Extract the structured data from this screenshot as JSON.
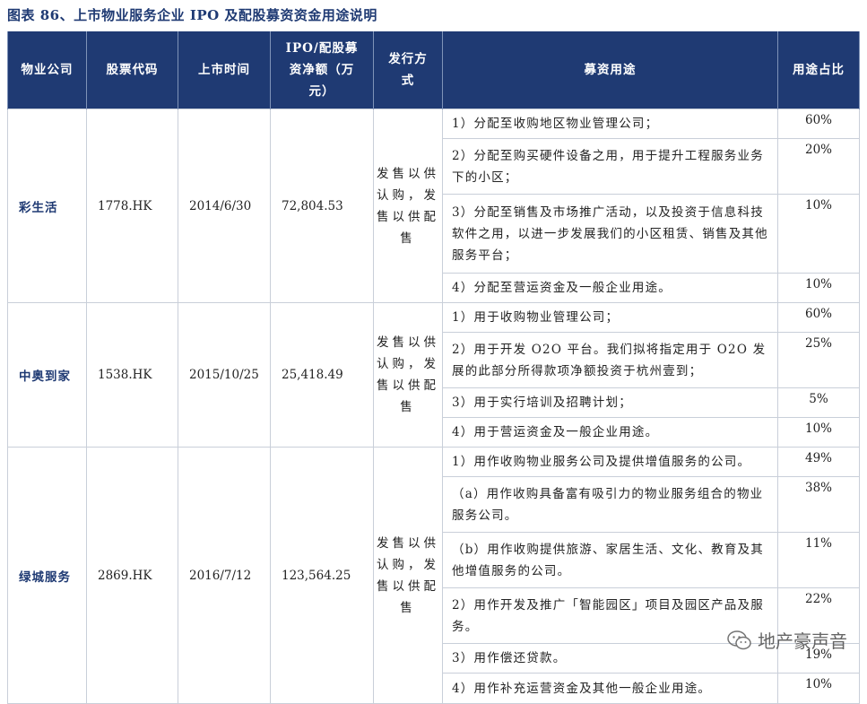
{
  "caption": "图表 86、上市物业服务企业 IPO 及配股募资资金用途说明",
  "headers": {
    "company": "物业公司",
    "code": "股票代码",
    "date": "上市时间",
    "amount": "IPO/配股募资净额（万元）",
    "method": "发行方式",
    "use": "募资用途",
    "pct": "用途占比"
  },
  "rows": [
    {
      "company": "彩生活",
      "code": "1778.HK",
      "date": "2014/6/30",
      "amount": "72,804.53",
      "method": "发售以供认购，发售以供配售",
      "uses": [
        {
          "text": "1）分配至收购地区物业管理公司；",
          "pct": "60%"
        },
        {
          "text": "2）分配至购买硬件设备之用，用于提升工程服务业务下的小区；",
          "pct": "20%"
        },
        {
          "text": "3）分配至销售及市场推广活动，以及投资于信息科技软件之用，以进一步发展我们的小区租赁、销售及其他服务平台；",
          "pct": "10%"
        },
        {
          "text": "4）分配至营运资金及一般企业用途。",
          "pct": "10%"
        }
      ]
    },
    {
      "company": "中奥到家",
      "code": "1538.HK",
      "date": "2015/10/25",
      "amount": "25,418.49",
      "method": "发售以供认购，发售以供配售",
      "uses": [
        {
          "text": "1）用于收购物业管理公司；",
          "pct": "60%"
        },
        {
          "text": "2）用于开发 O2O 平台。我们拟将指定用于 O2O 发展的此部分所得款项净额投资于杭州壹到；",
          "pct": "25%"
        },
        {
          "text": "3）用于实行培训及招聘计划；",
          "pct": "5%"
        },
        {
          "text": "4）用于营运资金及一般企业用途。",
          "pct": "10%"
        }
      ]
    },
    {
      "company": "绿城服务",
      "code": "2869.HK",
      "date": "2016/7/12",
      "amount": "123,564.25",
      "method": "发售以供认购，发售以供配售",
      "uses": [
        {
          "text": "1）用作收购物业服务公司及提供增值服务的公司。",
          "pct": "49%"
        },
        {
          "text": "（a）用作收购具备富有吸引力的物业服务组合的物业服务公司。",
          "pct": "38%"
        },
        {
          "text": "（b）用作收购提供旅游、家居生活、文化、教育及其他增值服务的公司。",
          "pct": "11%"
        },
        {
          "text": "2）用作开发及推广「智能园区」项目及园区产品及服务。",
          "pct": "22%"
        },
        {
          "text": "3）用作偿还贷款。",
          "pct": "19%"
        },
        {
          "text": "4）用作补充运营资金及其他一般企业用途。",
          "pct": "10%"
        }
      ]
    }
  ],
  "watermark": {
    "text": "地产豪声音",
    "icon": "wechat-icon"
  }
}
